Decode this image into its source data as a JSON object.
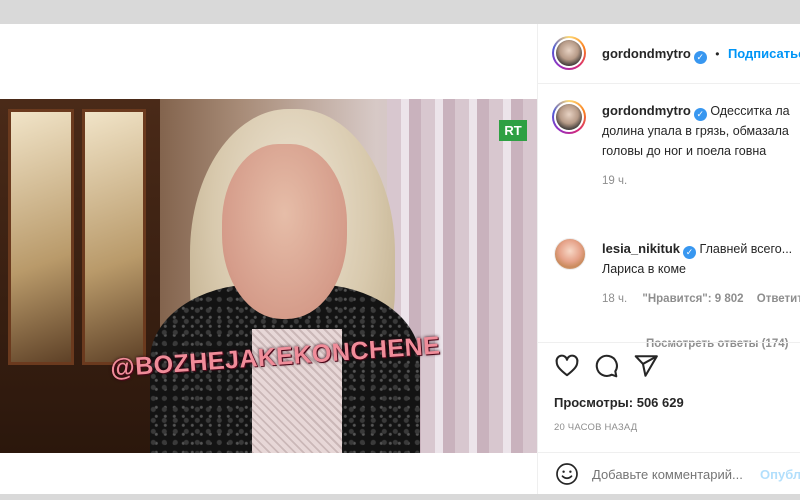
{
  "video": {
    "watermark": "@BOZHEJAKEKONCHENE",
    "channel_logo": "RT"
  },
  "header": {
    "username": "gordondmytro",
    "separator": "•",
    "follow_label": "Подписаться"
  },
  "caption": {
    "username": "gordondmytro",
    "text": "Одесситка лариса долина упала в грязь, обмазалась с головы до ног и поела говна",
    "line1": "Одесситка ла",
    "line2": "долина упала в грязь, обмазала",
    "line3": "головы до ног и поела говна",
    "time": "19 ч."
  },
  "comment": {
    "username": "lesia_nikituk",
    "text_line1": "Главней всего...",
    "text_line2": "Лариса в коме",
    "time": "18 ч.",
    "likes": "\"Нравится\": 9 802",
    "reply_label": "Ответить",
    "view_replies": "Посмотреть ответы (174)"
  },
  "actions": {
    "views_label": "Просмотры:",
    "views_count": "506 629",
    "posted_time": "20 ЧАСОВ НАЗАД"
  },
  "add_comment": {
    "placeholder": "Добавьте комментарий...",
    "post_label": "Опубликовать"
  },
  "icons": {
    "like": "heart-icon",
    "comment": "speech-bubble-icon",
    "share": "paper-plane-icon",
    "emoji": "smiley-icon",
    "verified": "verified-badge-icon"
  },
  "colors": {
    "link_blue": "#0095f6",
    "verified_blue": "#3897f0",
    "muted_text": "#8e8e8e",
    "watermark_pink": "#f08c99",
    "rt_green": "#2ea043"
  }
}
